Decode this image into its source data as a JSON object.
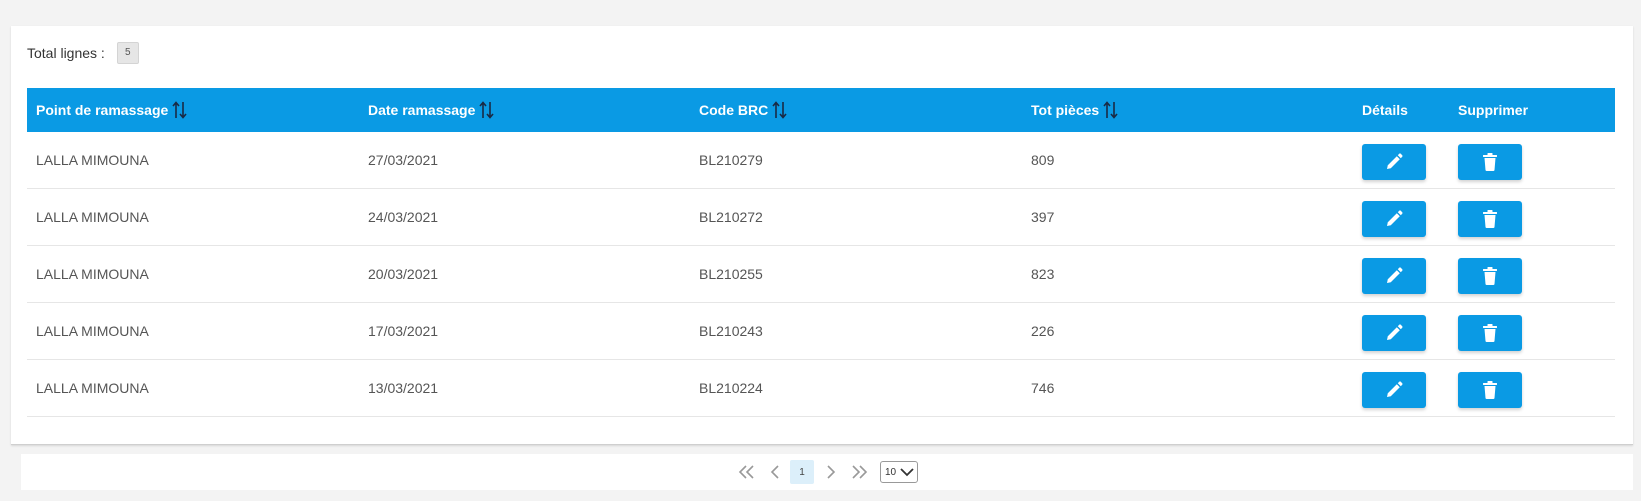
{
  "summary": {
    "label": "Total lignes :",
    "count": "5"
  },
  "table": {
    "columns": [
      "Point de ramassage",
      "Date ramassage",
      "Code BRC",
      "Tot pièces",
      "Détails",
      "Supprimer"
    ],
    "rows": [
      [
        "LALLA MIMOUNA",
        "27/03/2021",
        "BL210279",
        "809"
      ],
      [
        "LALLA MIMOUNA",
        "24/03/2021",
        "BL210272",
        "397"
      ],
      [
        "LALLA MIMOUNA",
        "20/03/2021",
        "BL210255",
        "823"
      ],
      [
        "LALLA MIMOUNA",
        "17/03/2021",
        "BL210243",
        "226"
      ],
      [
        "LALLA MIMOUNA",
        "13/03/2021",
        "BL210224",
        "746"
      ]
    ],
    "row_actions": [
      "pencil-icon",
      "trash-icon"
    ]
  },
  "pagination": {
    "current_page": "1",
    "rows_per_page": "10",
    "icons": [
      "double-chevron-left-icon",
      "chevron-left-icon",
      "chevron-right-icon",
      "double-chevron-right-icon",
      "chevron-down-icon"
    ]
  },
  "colors": {
    "accent": "#0a9ae4",
    "header_text": "#ffffff",
    "current_page_bg": "#dceffa"
  }
}
